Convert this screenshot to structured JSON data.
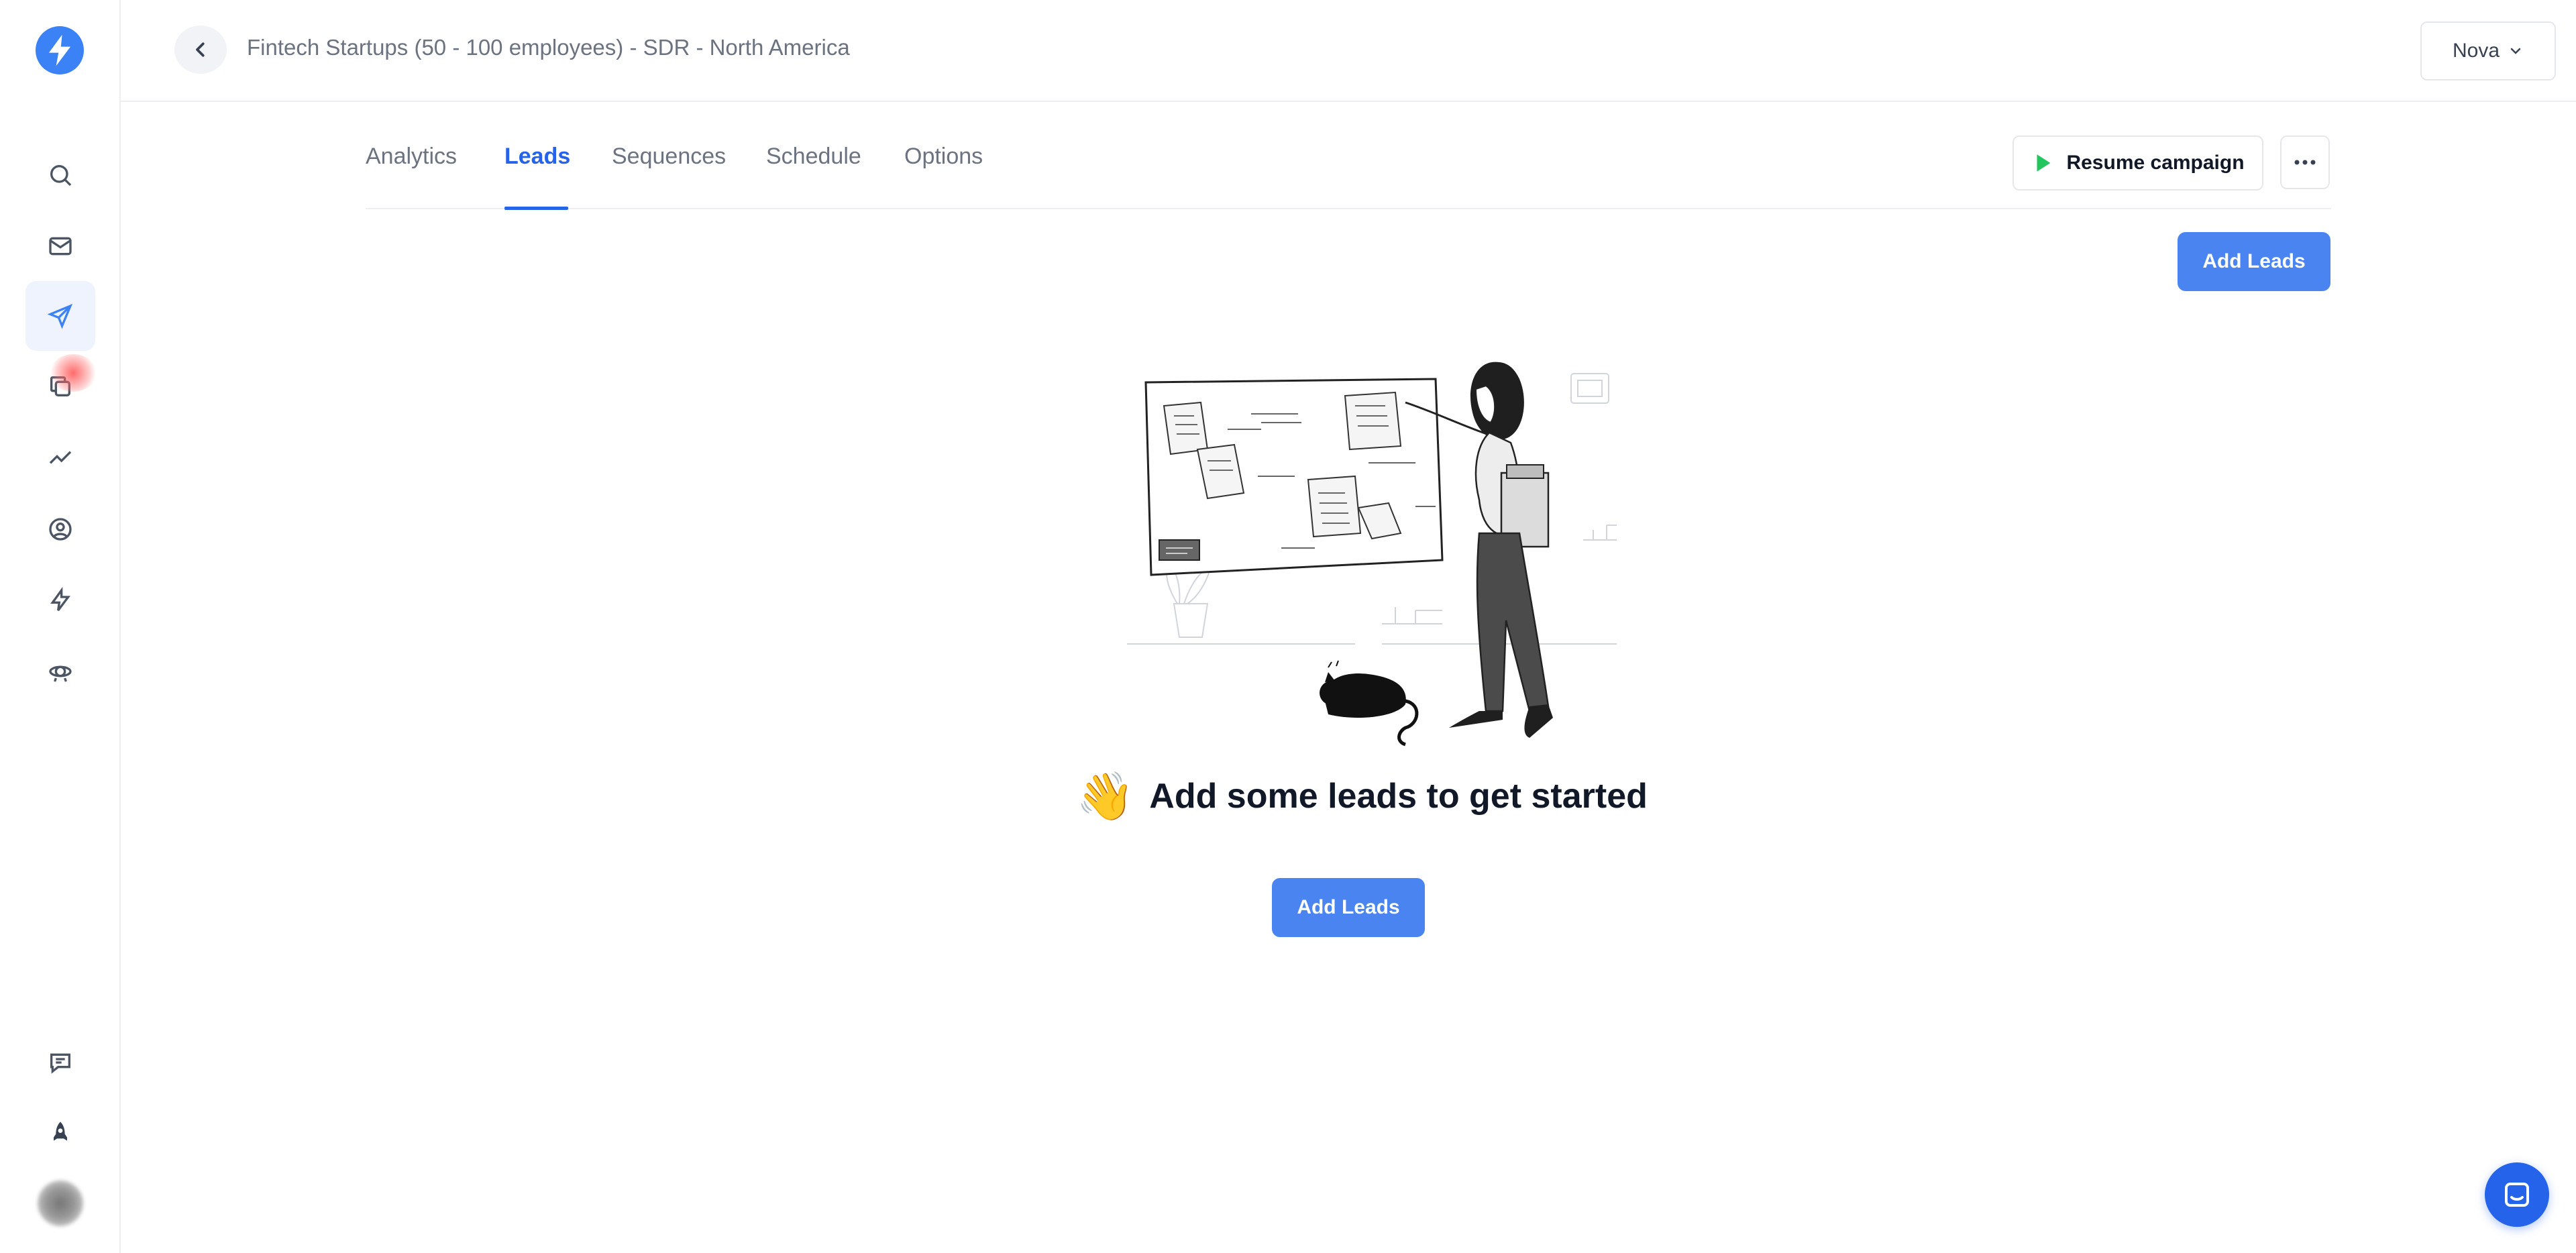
{
  "sidebar": {
    "items": [
      {
        "name": "search",
        "icon": "search-icon"
      },
      {
        "name": "inbox",
        "icon": "mail-icon"
      },
      {
        "name": "campaigns",
        "icon": "send-icon",
        "active": true
      },
      {
        "name": "templates",
        "icon": "copy-icon"
      },
      {
        "name": "analytics",
        "icon": "trend-icon"
      },
      {
        "name": "contacts",
        "icon": "user-circle-icon"
      },
      {
        "name": "automations",
        "icon": "bolt-icon"
      },
      {
        "name": "integrations",
        "icon": "satellite-icon"
      }
    ],
    "bottom": [
      {
        "name": "feedback",
        "icon": "chat-edit-icon"
      },
      {
        "name": "launch",
        "icon": "rocket-icon"
      }
    ]
  },
  "header": {
    "campaign_title": "Fintech Startups (50 - 100 employees) - SDR - North America",
    "account_name": "Nova"
  },
  "tabs": [
    {
      "label": "Analytics",
      "active": false
    },
    {
      "label": "Leads",
      "active": true
    },
    {
      "label": "Sequences",
      "active": false
    },
    {
      "label": "Schedule",
      "active": false
    },
    {
      "label": "Options",
      "active": false
    }
  ],
  "actions": {
    "resume_label": "Resume campaign",
    "add_leads_label": "Add Leads"
  },
  "empty_state": {
    "emoji": "👋",
    "title": "Add some leads to get started",
    "button_label": "Add Leads"
  },
  "colors": {
    "primary": "#4a84f0",
    "active_tab": "#2563eb",
    "play": "#22c55e"
  }
}
